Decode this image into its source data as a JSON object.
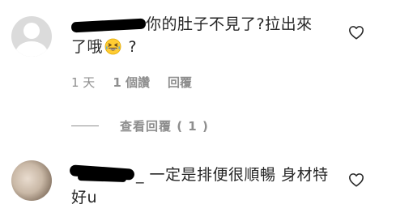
{
  "comments": [
    {
      "text_1": "你的肚子不見了?拉出來",
      "text_2": "了哦",
      "text_3": " ?",
      "emoji_icon": "grinning-squinting-face-emoji",
      "time": "1 天",
      "likes": "1 個讚",
      "reply_label": "回覆",
      "view_replies_label": "查看回覆 ( 1 )",
      "heart_icon": "heart-outline-icon"
    },
    {
      "text_prefix": "_",
      "text": " 一定是排便很順暢 身材特好u",
      "heart_icon": "heart-outline-icon"
    }
  ],
  "colors": {
    "text": "#262626",
    "secondary": "#8e8e8e",
    "avatar_placeholder": "#dbdbdb"
  }
}
